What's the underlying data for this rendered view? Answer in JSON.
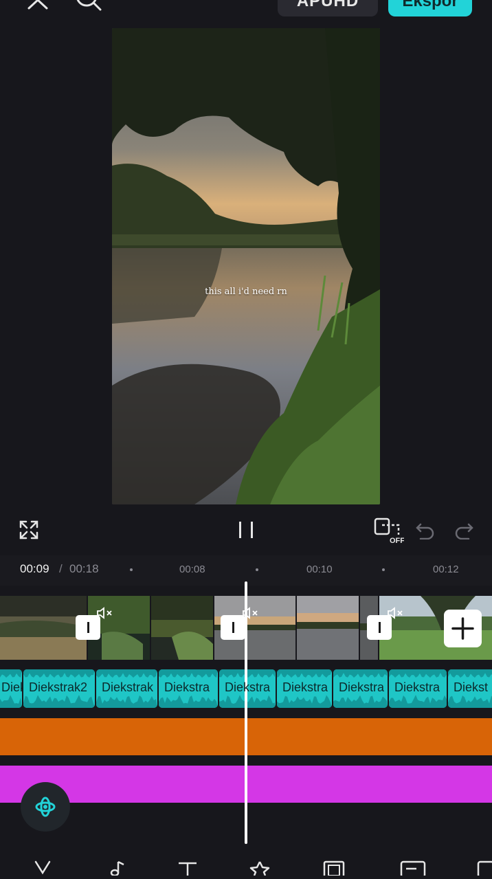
{
  "header": {
    "close_icon": "close-icon",
    "search_icon": "search-icon",
    "resolution_label": "APUHD",
    "export_label": "Ekspor"
  },
  "preview": {
    "caption": "this all i'd need rn"
  },
  "controls": {
    "fullscreen_icon": "fullscreen-icon",
    "play_pause_icon": "pause-icon",
    "compare_icon": "compare-off-icon",
    "compare_badge": "OFF",
    "undo_icon": "undo-icon",
    "redo_icon": "redo-icon"
  },
  "timeline": {
    "current_time": "00:09",
    "separator": "/",
    "total_time": "00:18",
    "ticks": [
      "00:08",
      "00:10",
      "00:12"
    ]
  },
  "audio_segments": [
    "Diekstr",
    "Diekstrak2",
    "Diekstrak",
    "Diekstra",
    "Diekstra",
    "Diekstra",
    "Diekstra",
    "Diekstra",
    "Diekst"
  ],
  "colors": {
    "accent": "#22d3d8",
    "audio_track": "#1fc6c6",
    "effect_track_1": "#d86407",
    "effect_track_2": "#d437e6",
    "background": "#17171c"
  },
  "bottom_toolbar_icons": [
    "edit-icon",
    "audio-icon",
    "text-icon",
    "effects-icon",
    "overlay-icon",
    "captions-icon",
    "filter-icon"
  ]
}
